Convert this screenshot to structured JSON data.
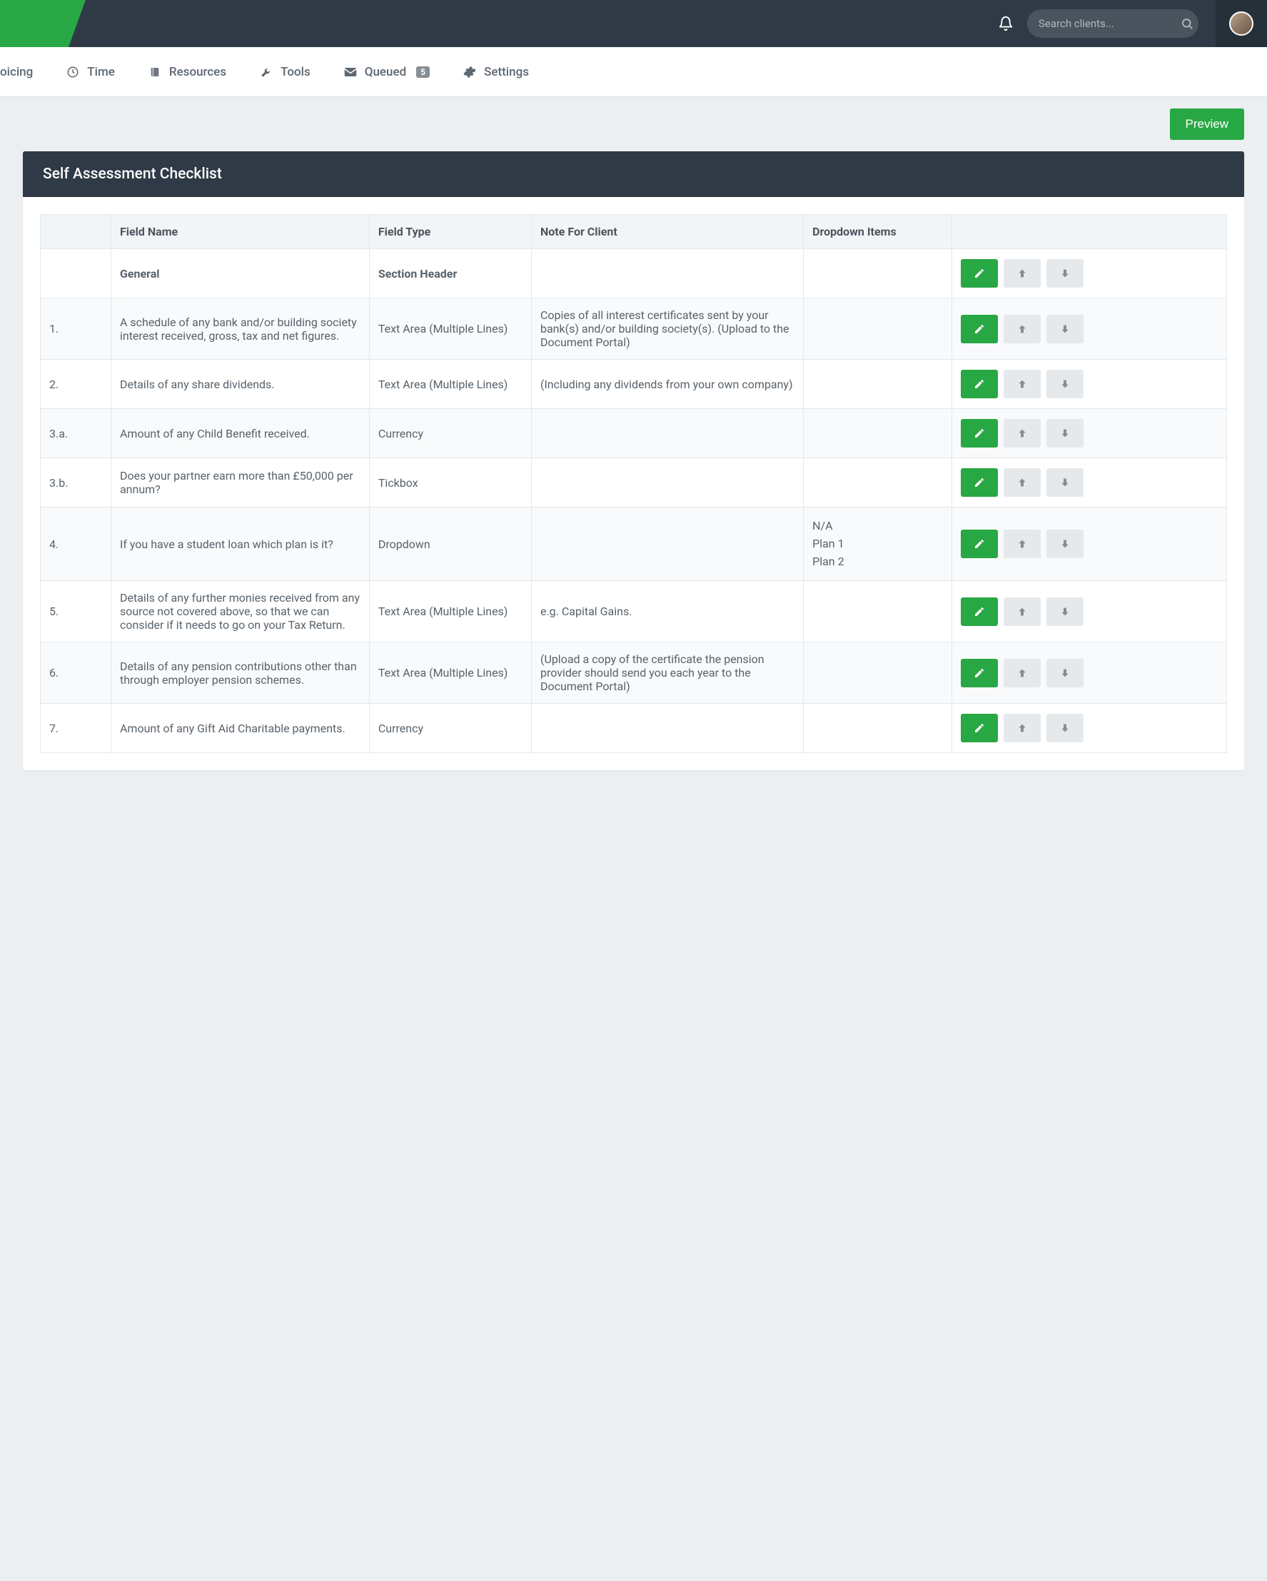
{
  "search": {
    "placeholder": "Search clients..."
  },
  "nav": {
    "invoicing": "oicing",
    "time": "Time",
    "resources": "Resources",
    "tools": "Tools",
    "queued": "Queued",
    "queued_count": "5",
    "settings": "Settings"
  },
  "actions": {
    "preview": "Preview"
  },
  "card": {
    "title": "Self Assessment Checklist"
  },
  "table": {
    "headers": {
      "num": "",
      "name": "Field Name",
      "type": "Field Type",
      "note": "Note For Client",
      "dropdown": "Dropdown Items",
      "actions": ""
    },
    "rows": [
      {
        "num": "",
        "name": "General",
        "type": "Section Header",
        "note": "",
        "dropdown": [],
        "is_section": true
      },
      {
        "num": "1.",
        "name": "A schedule of any bank and/or building society interest received, gross, tax and net figures.",
        "type": "Text Area (Multiple Lines)",
        "note": "Copies of all interest certificates sent by your bank(s) and/or building society(s). (Upload to the Document Portal)",
        "dropdown": []
      },
      {
        "num": "2.",
        "name": "Details of any share dividends.",
        "type": "Text Area (Multiple Lines)",
        "note": "(Including any dividends from your own company)",
        "dropdown": []
      },
      {
        "num": "3.a.",
        "name": "Amount of any Child Benefit received.",
        "type": "Currency",
        "note": "",
        "dropdown": []
      },
      {
        "num": "3.b.",
        "name": "Does your partner earn more than £50,000 per annum?",
        "type": "Tickbox",
        "note": "",
        "dropdown": []
      },
      {
        "num": "4.",
        "name": "If you have a student loan which plan is it?",
        "type": "Dropdown",
        "note": "",
        "dropdown": [
          "N/A",
          "Plan 1",
          "Plan 2"
        ]
      },
      {
        "num": "5.",
        "name": "Details of any further monies received from any source not covered above, so that we can consider if it needs to go on your Tax Return.",
        "type": "Text Area (Multiple Lines)",
        "note": "e.g. Capital Gains.",
        "dropdown": []
      },
      {
        "num": "6.",
        "name": "Details of any pension contributions other than through employer pension schemes.",
        "type": "Text Area (Multiple Lines)",
        "note": "(Upload a copy of the certificate the pension provider should send you each year to the Document Portal)",
        "dropdown": []
      },
      {
        "num": "7.",
        "name": "Amount of any Gift Aid Charitable payments.",
        "type": "Currency",
        "note": "",
        "dropdown": []
      }
    ]
  }
}
